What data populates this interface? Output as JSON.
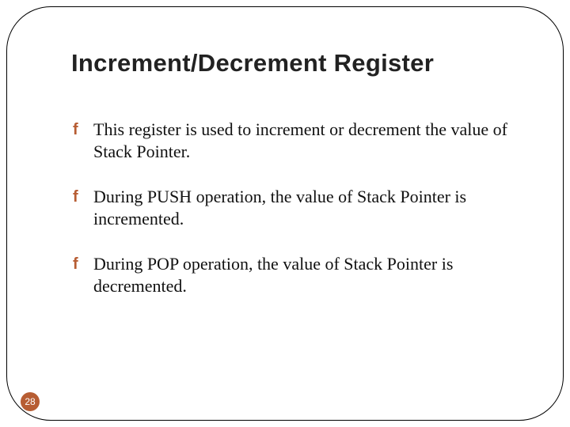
{
  "slide": {
    "title": "Increment/Decrement Register",
    "bullets": [
      "This register is used to increment or decrement the value of Stack Pointer.",
      "During PUSH operation, the value of Stack Pointer is incremented.",
      "During POP operation, the value of Stack Pointer is decremented."
    ],
    "pageNumber": "28",
    "bulletGlyph": "f"
  },
  "colors": {
    "accent": "#b75d33"
  }
}
